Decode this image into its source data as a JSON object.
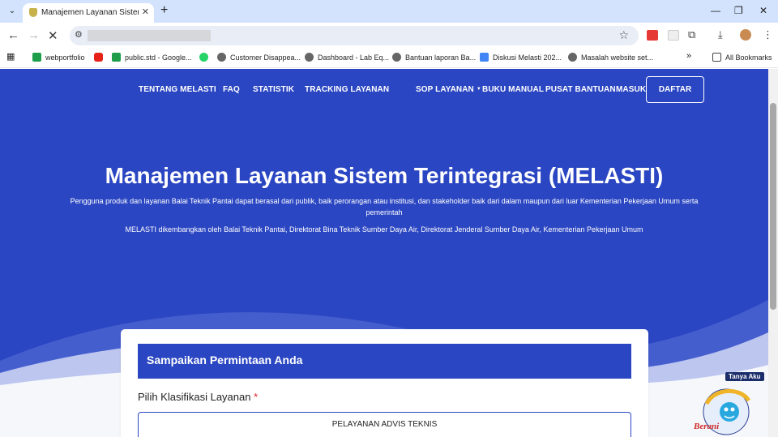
{
  "browser": {
    "tab_title": "Manajemen Layanan Sistem Ter",
    "bookmarks": [
      {
        "label": "webportfolio"
      },
      {
        "label": "public.std - Google..."
      },
      {
        "label": "Customer Disappea..."
      },
      {
        "label": "Dashboard - Lab Eq..."
      },
      {
        "label": "Bantuan laporan Ba..."
      },
      {
        "label": "Diskusi Melasti 202..."
      },
      {
        "label": "Masalah website set..."
      }
    ],
    "all_bookmarks": "All Bookmarks"
  },
  "nav": {
    "items": [
      "TENTANG MELASTI",
      "FAQ",
      "STATISTIK",
      "TRACKING LAYANAN",
      "SOP LAYANAN",
      "BUKU MANUAL",
      "PUSAT BANTUAN",
      "MASUK"
    ],
    "register": "DAFTAR"
  },
  "hero": {
    "title": "Manajemen Layanan Sistem Terintegrasi (MELASTI)",
    "description": "Pengguna produk dan layanan Balai Teknik Pantai dapat berasal dari publik, baik perorangan atau institusi, dan stakeholder baik dari dalam maupun dari luar Kementerian Pekerjaan Umum serta pemerintah",
    "description2": "MELASTI dikembangkan oleh Balai Teknik Pantai, Direktorat Bina Teknik Sumber Daya Air, Direktorat Jenderal Sumber Daya Air, Kementerian Pekerjaan Umum"
  },
  "form": {
    "header": "Sampaikan Permintaan Anda",
    "label": "Pilih Klasifikasi Layanan",
    "required_mark": "*",
    "option": "PELAYANAN ADVIS TEKNIS"
  },
  "chat_widget": {
    "label": "Tanya Aku",
    "brand": "Berani"
  },
  "colors": {
    "primary": "#2b46c2",
    "tabstrip": "#d3e3fd"
  }
}
